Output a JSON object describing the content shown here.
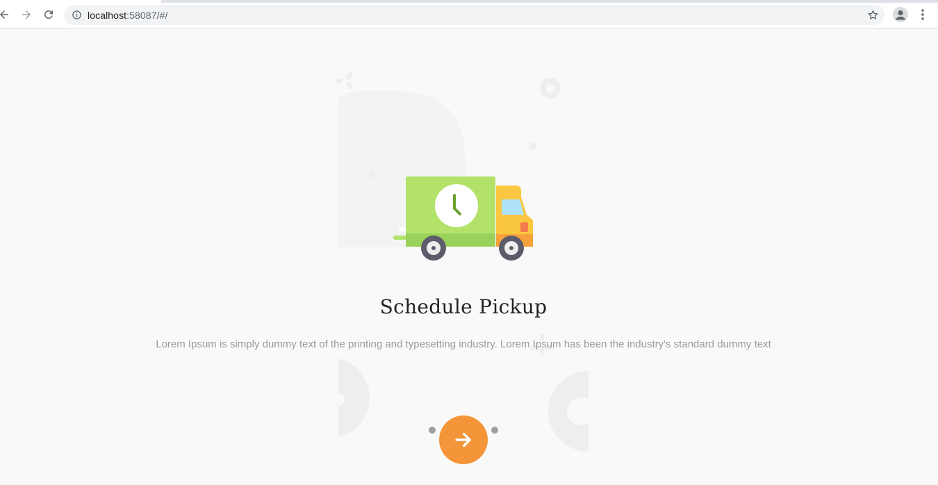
{
  "browser": {
    "url_host": "localhost",
    "url_rest": ":58087/#/",
    "icons": [
      "back-arrow-icon",
      "forward-arrow-icon",
      "reload-icon",
      "info-icon",
      "star-icon",
      "profile-icon",
      "more-vert-icon"
    ]
  },
  "onboarding": {
    "title": "Schedule Pickup",
    "description": "Lorem Ipsum is simply dummy text of the printing and typesetting industry. Lorem Ipsum has been the industry's standard dummy text",
    "illustration": "delivery-truck-clock",
    "page_count": 3,
    "current_page": 2
  },
  "colors": {
    "accent": "#f39538",
    "truck_body": "#b3e26a",
    "truck_cab": "#fbc740",
    "dot": "#9e9e9e",
    "background": "#f9f9f9"
  }
}
